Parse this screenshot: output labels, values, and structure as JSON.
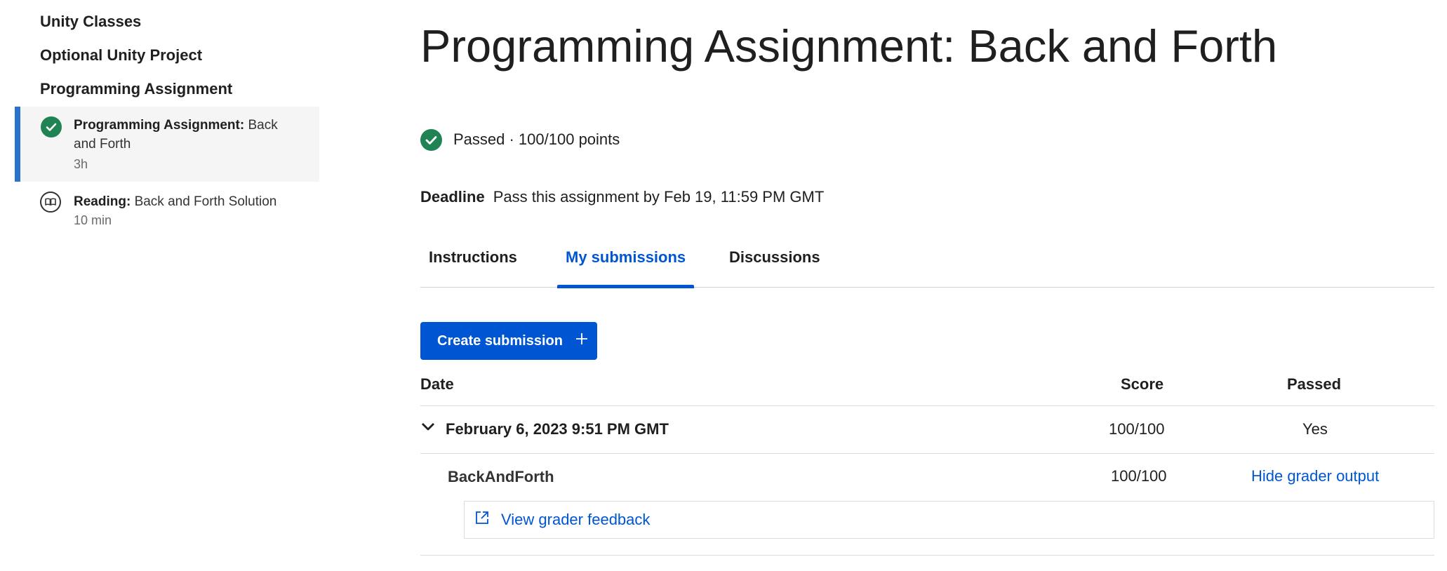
{
  "sidebar": {
    "headings": [
      "Unity Classes",
      "Optional Unity Project",
      "Programming Assignment"
    ],
    "items": [
      {
        "type_label": "Programming Assignment:",
        "title": "Back and Forth",
        "meta": "3h",
        "icon": "check-circle-icon",
        "active": true
      },
      {
        "type_label": "Reading:",
        "title": "Back and Forth Solution",
        "meta": "10 min",
        "icon": "book-icon",
        "active": false
      }
    ]
  },
  "main": {
    "title": "Programming Assignment: Back and Forth",
    "status_text": "Passed · 100/100 points",
    "deadline_label": "Deadline",
    "deadline_text": "Pass this assignment by Feb 19, 11:59 PM GMT",
    "tabs": [
      {
        "label": "Instructions",
        "active": false
      },
      {
        "label": "My submissions",
        "active": true
      },
      {
        "label": "Discussions",
        "active": false
      }
    ],
    "create_button": "Create submission",
    "table": {
      "headers": {
        "date": "Date",
        "score": "Score",
        "passed": "Passed"
      },
      "submission": {
        "date": "February 6, 2023 9:51 PM GMT",
        "score": "100/100",
        "passed": "Yes"
      },
      "part": {
        "name": "BackAndForth",
        "score": "100/100",
        "action": "Hide grader output"
      },
      "feedback_link": "View grader feedback"
    }
  },
  "colors": {
    "accent": "#0056d2",
    "success": "#1f8354",
    "active_bar": "#2a73cc"
  }
}
